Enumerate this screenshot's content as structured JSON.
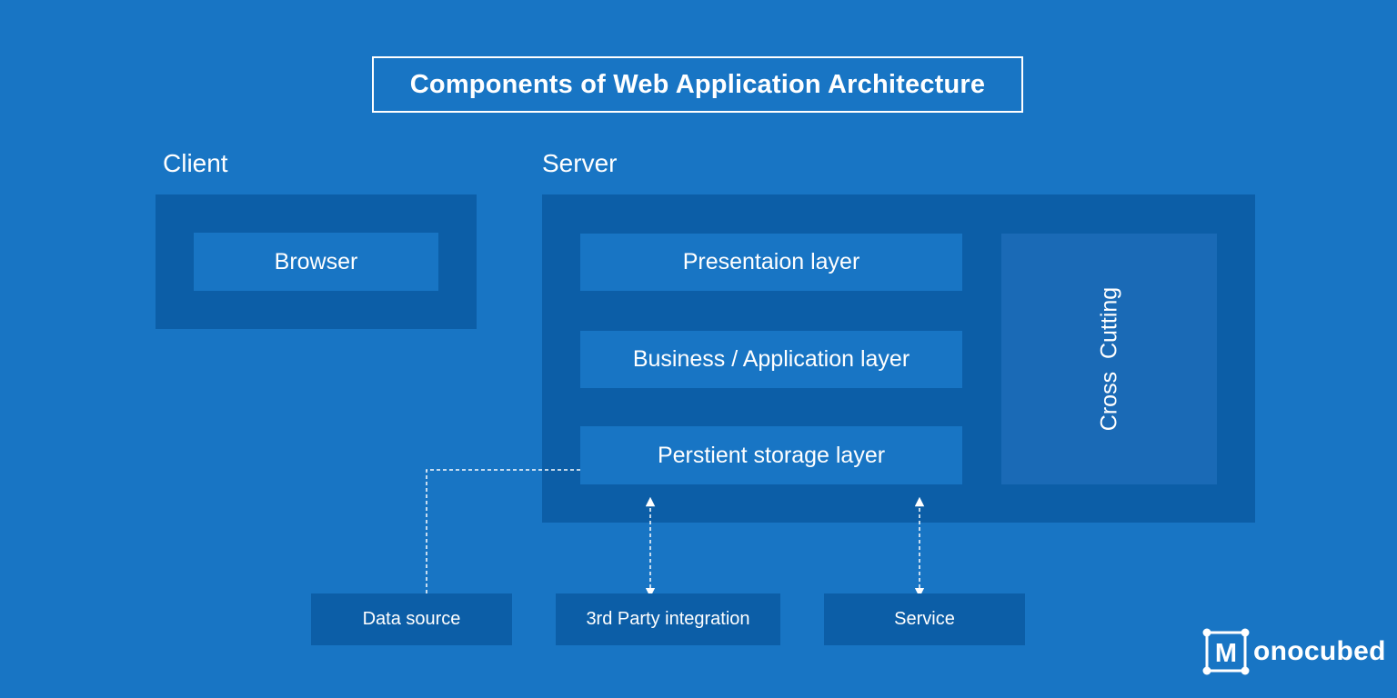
{
  "title": "Components of Web Application Architecture",
  "client": {
    "label": "Client",
    "browser": "Browser"
  },
  "server": {
    "label": "Server",
    "layers": {
      "presentation": "Presentaion layer",
      "business": "Business / Application layer",
      "persistent": "Perstient storage layer"
    },
    "cross_cutting": "Cross  Cutting"
  },
  "external": {
    "data_source": "Data source",
    "third_party": "3rd Party integration",
    "service": "Service"
  },
  "logo": {
    "mark_letter": "M",
    "text": "onocubed"
  },
  "colors": {
    "background": "#1875c4",
    "panel": "#0c5ea7",
    "text": "#ffffff"
  }
}
